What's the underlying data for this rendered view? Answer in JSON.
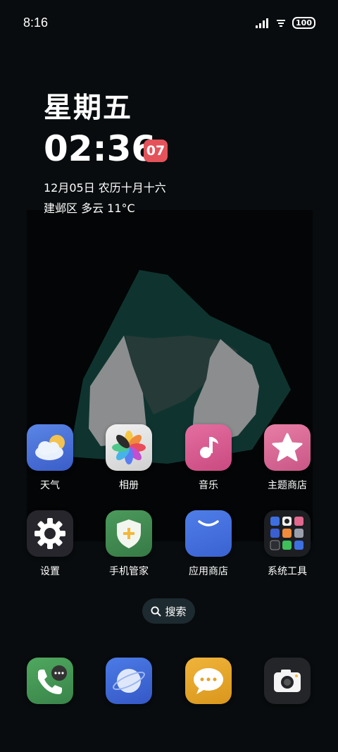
{
  "status": {
    "time": "8:16",
    "battery": "100"
  },
  "clock": {
    "weekday": "星期五",
    "time": "02:36",
    "seconds": "07",
    "date": "12月05日 农历十月十六",
    "weather": "建邺区 多云 11°C"
  },
  "apps": {
    "weather": "天气",
    "gallery": "相册",
    "music": "音乐",
    "theme_store": "主题商店",
    "settings": "设置",
    "phone_manager": "手机管家",
    "app_store": "应用商店",
    "system_tools": "系统工具"
  },
  "search": {
    "label": "搜索"
  },
  "colors": {
    "accent_red": "#e4535a",
    "background": "#080c0e"
  }
}
